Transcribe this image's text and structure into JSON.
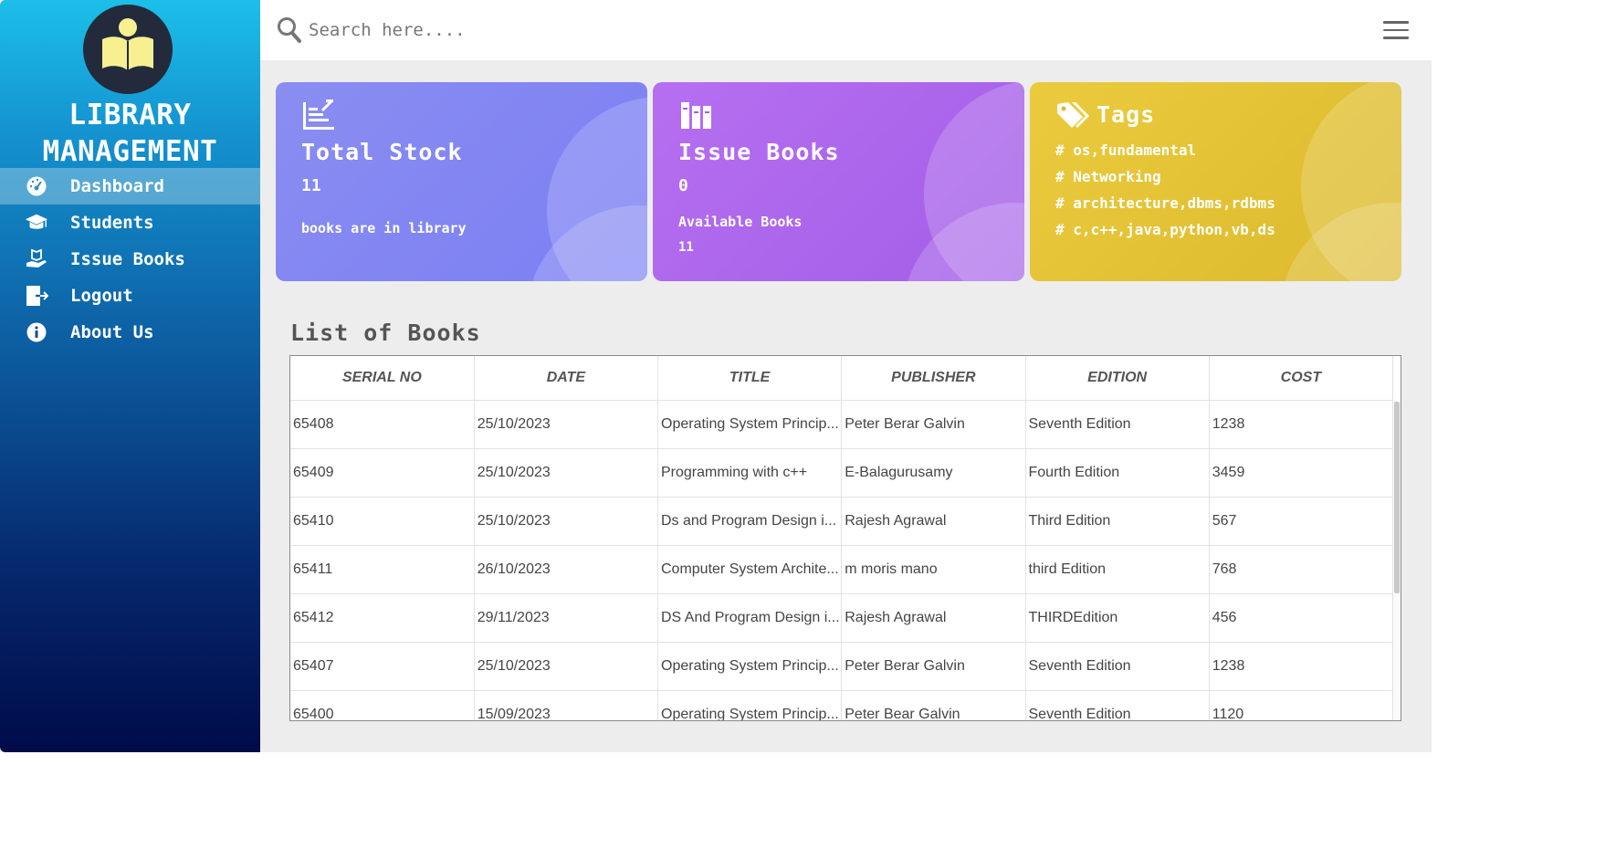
{
  "sidebar": {
    "brand_line1": "LIBRARY",
    "brand_line2": "MANAGEMENT",
    "logo_icon": "book-reader-icon",
    "items": [
      {
        "label": "Dashboard",
        "icon": "dashboard-gauge-icon",
        "active": true
      },
      {
        "label": "Students",
        "icon": "graduation-cap-icon",
        "active": false
      },
      {
        "label": "Issue Books",
        "icon": "hand-book-icon",
        "active": false
      },
      {
        "label": "Logout",
        "icon": "logout-icon",
        "active": false
      },
      {
        "label": "About Us",
        "icon": "info-icon",
        "active": false
      }
    ]
  },
  "search": {
    "placeholder": "Search here....",
    "value": ""
  },
  "cards": {
    "stock": {
      "title": "Total Stock",
      "count": "11",
      "subtitle": "books are in library",
      "icon": "stock-list-icon"
    },
    "issue": {
      "title": "Issue Books",
      "count": "0",
      "subtitle": "Available Books",
      "subcount": "11",
      "icon": "books-icon"
    },
    "tags": {
      "title": "Tags",
      "icon": "tags-icon",
      "lines": [
        "# os,fundamental",
        "# Networking",
        "# architecture,dbms,rdbms",
        "# c,c++,java,python,vb,ds"
      ]
    }
  },
  "books": {
    "title": "List of Books",
    "columns": [
      "SERIAL NO",
      "DATE",
      "TITLE",
      "PUBLISHER",
      "EDITION",
      "COST"
    ],
    "rows": [
      [
        "65408",
        "25/10/2023",
        "Operating System Princip...",
        "Peter Berar Galvin",
        "Seventh Edition",
        "1238"
      ],
      [
        "65409",
        "25/10/2023",
        "Programming with c++",
        "E-Balagurusamy",
        "Fourth Edition",
        "3459"
      ],
      [
        "65410",
        "25/10/2023",
        "Ds and Program Design i...",
        "Rajesh Agrawal",
        "Third Edition",
        "567"
      ],
      [
        "65411",
        "26/10/2023",
        "Computer System Archite...",
        "m moris mano",
        "third Edition",
        "768"
      ],
      [
        "65412",
        "29/11/2023",
        "DS And Program Design i...",
        "Rajesh Agrawal",
        "THIRDEdition",
        "456"
      ],
      [
        "65407",
        "25/10/2023",
        "Operating System Princip...",
        "Peter Berar Galvin",
        "Seventh Edition",
        "1238"
      ],
      [
        "65400",
        "15/09/2023",
        "Operating System Princip...",
        "Peter Bear Galvin",
        "Seventh Edition",
        "1120"
      ]
    ]
  },
  "colors": {
    "stock_card": "#7b7ff4",
    "issue_card": "#a35ee8",
    "tags_card": "#dcb92d",
    "sidebar_top": "#1cbfe9",
    "sidebar_bottom": "#000b49"
  }
}
